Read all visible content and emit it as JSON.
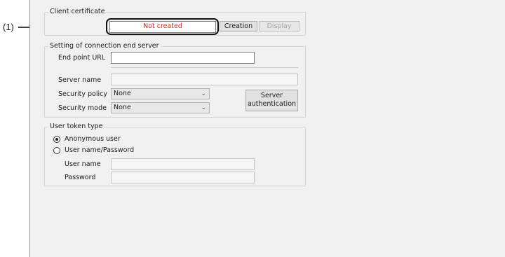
{
  "callout": {
    "label": "(1)"
  },
  "client_certificate": {
    "legend": "Client certificate",
    "status": "Not created",
    "status_color": "#e02020",
    "creation_label": "Creation",
    "display_label": "Display"
  },
  "connection": {
    "legend": "Setting of connection end server",
    "endpoint_label": "End point URL",
    "endpoint_value": "",
    "server_name_label": "Server name",
    "server_name_value": "",
    "policy_label": "Security policy",
    "policy_value": "None",
    "mode_label": "Security mode",
    "mode_value": "None",
    "server_auth_line1": "Server",
    "server_auth_line2": "authentication"
  },
  "user_token": {
    "legend": "User token type",
    "anonymous_label": "Anonymous user",
    "anonymous_selected": true,
    "userpass_label": "User name/Password",
    "username_label": "User name",
    "username_value": "",
    "password_label": "Password",
    "password_value": ""
  }
}
